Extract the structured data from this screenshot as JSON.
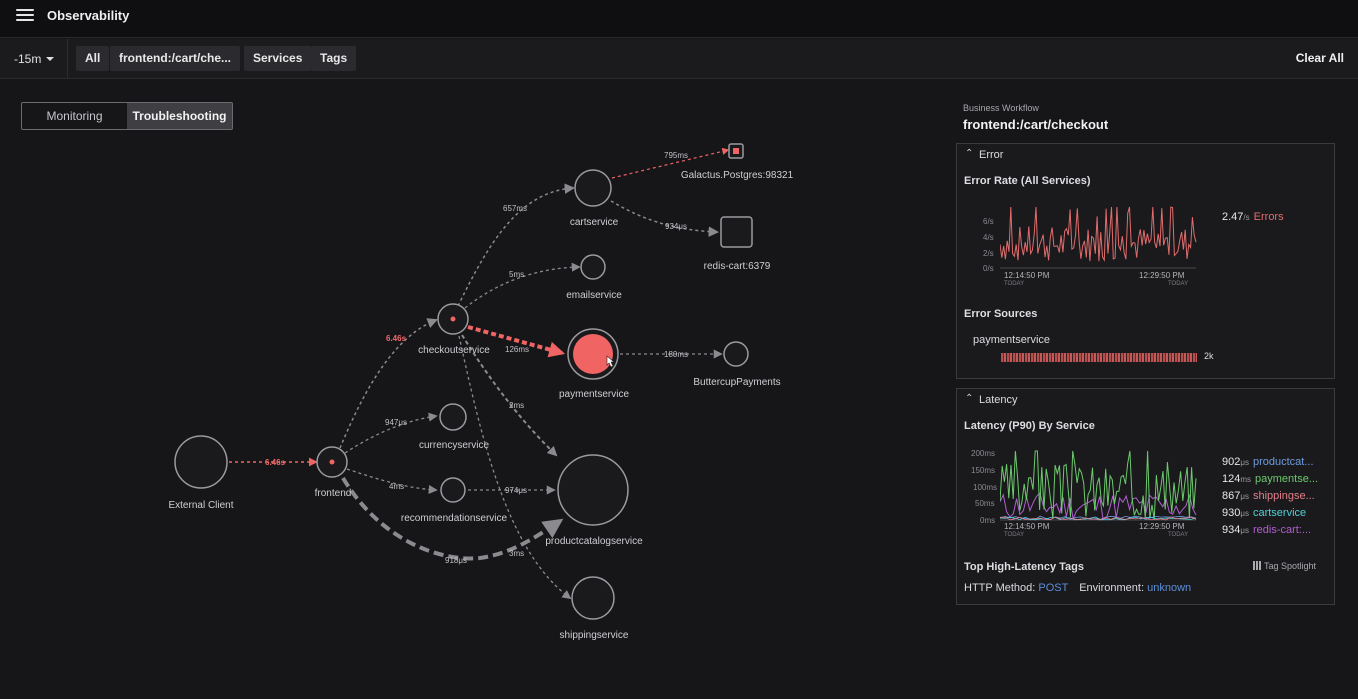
{
  "app": {
    "title": "Observability"
  },
  "filters": {
    "time_range": "-15m",
    "chips": [
      "All",
      "frontend:/cart/che...",
      "Services",
      "Tags"
    ],
    "clear_all": "Clear All"
  },
  "view_toggle": {
    "monitoring": "Monitoring",
    "troubleshooting": "Troubleshooting",
    "active": "Troubleshooting"
  },
  "service_map": {
    "nodes": {
      "external_client": "External Client",
      "frontend": "frontend",
      "checkoutservice": "checkoutservice",
      "cartservice": "cartservice",
      "galactus": "Galactus.Postgres:98321",
      "redis": "redis-cart:6379",
      "emailservice": "emailservice",
      "paymentservice": "paymentservice",
      "buttercup": "ButtercupPayments",
      "currencyservice": "currencyservice",
      "recommendationservice": "recommendationservice",
      "productcatalogservice": "productcatalogservice",
      "shippingservice": "shippingservice"
    },
    "edges": {
      "client_frontend": "6.46s",
      "frontend_checkout": "6.46s",
      "checkout_cart": "657ms",
      "cart_galactus": "795ms",
      "cart_redis": "934μs",
      "checkout_email": "5ms",
      "checkout_payment": "126ms",
      "payment_buttercup": "180ms",
      "checkout_productcatalog": "2ms",
      "frontend_currency": "947μs",
      "frontend_recommendation": "4ms",
      "recommendation_productcatalog": "974μs",
      "frontend_productcatalog": "918μs",
      "checkout_shipping": "3ms"
    },
    "colors": {
      "error": "#f06464",
      "node_stroke": "#9a9a9f",
      "edge": "#8a8a8f"
    }
  },
  "sidebar": {
    "workflow_label": "Business Workflow",
    "workflow_name": "frontend:/cart/checkout",
    "error_panel": {
      "title": "Error",
      "rate_title": "Error Rate (All Services)",
      "y_ticks": [
        "6/s",
        "4/s",
        "2/s",
        "0/s"
      ],
      "time_start": "12:14:50 PM",
      "time_end": "12:29:50 PM",
      "day_label": "TODAY",
      "current_value": "2.47",
      "current_unit": "/s",
      "current_label": "Errors",
      "sources_title": "Error Sources",
      "source_name": "paymentservice",
      "source_count": "2k"
    },
    "latency_panel": {
      "title": "Latency",
      "chart_title": "Latency (P90) By Service",
      "y_ticks": [
        "200ms",
        "150ms",
        "100ms",
        "50ms",
        "0ms"
      ],
      "time_start": "12:14:50 PM",
      "time_end": "12:29:50 PM",
      "day_label": "TODAY",
      "legend": [
        {
          "value": "902",
          "unit": "μs",
          "name": "productcat...",
          "color": "#6f9be0"
        },
        {
          "value": "124",
          "unit": "ms",
          "name": "paymentse...",
          "color": "#6cc96c"
        },
        {
          "value": "867",
          "unit": "μs",
          "name": "shippingse...",
          "color": "#e37f8a"
        },
        {
          "value": "930",
          "unit": "μs",
          "name": "cartservice",
          "color": "#4fd0d8"
        },
        {
          "value": "934",
          "unit": "μs",
          "name": "redis-cart:...",
          "color": "#b05fd0"
        }
      ],
      "tags_title": "Top High-Latency Tags",
      "spotlight_label": "Tag Spotlight",
      "tag1_key": "HTTP Method:",
      "tag1_value": "POST",
      "tag2_key": "Environment:",
      "tag2_value": "unknown"
    }
  }
}
